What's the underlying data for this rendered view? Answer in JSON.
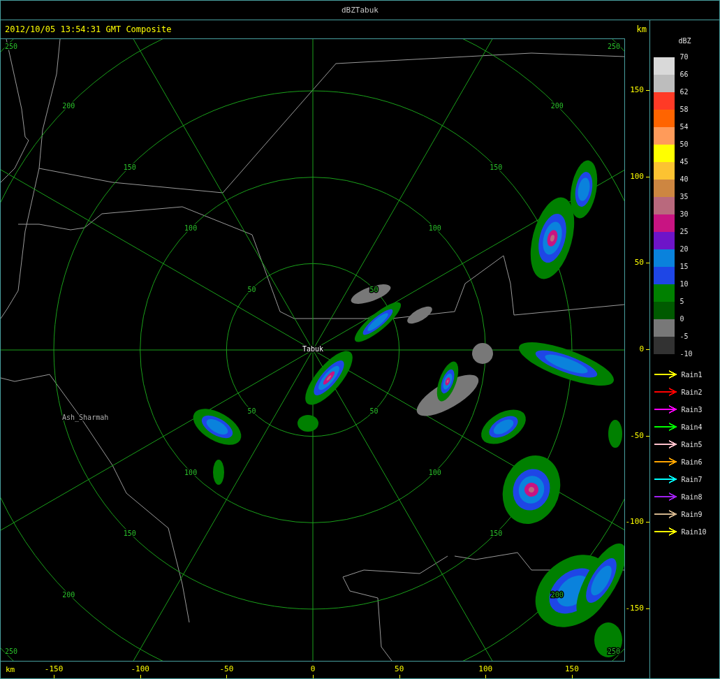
{
  "window": {
    "title": "dBZTabuk"
  },
  "header": {
    "timestamp": "2012/10/05 13:54:31 GMT Composite",
    "unit": "km"
  },
  "map": {
    "rings": [
      {
        "labels": [
          "50",
          "50",
          "50",
          "50"
        ]
      },
      {
        "labels": [
          "100",
          "100",
          "100",
          "100"
        ]
      },
      {
        "labels": [
          "150",
          "150",
          "150",
          "150"
        ]
      },
      {
        "labels": [
          "200",
          "200",
          "200",
          "200"
        ]
      },
      {
        "labels": [
          "250",
          "250",
          "250",
          "250"
        ]
      }
    ],
    "places": [
      {
        "kind": "station",
        "name": "Tabuk"
      },
      {
        "kind": "town",
        "name": "Ash_Sharmah"
      }
    ]
  },
  "x_axis": {
    "unit": "km",
    "ticks": [
      "-150",
      "-100",
      "-50",
      "0",
      "50",
      "100",
      "150"
    ]
  },
  "y_axis": {
    "ticks": [
      "150",
      "100",
      "50",
      "0",
      "-50",
      "-100",
      "-150"
    ]
  },
  "legend": {
    "title": "dBZ",
    "bands": [
      {
        "color": "#d9d9d9"
      },
      {
        "color": "#bdbdbd"
      },
      {
        "color": "#ff3a26"
      },
      {
        "color": "#ff6400"
      },
      {
        "color": "#ff9b5a"
      },
      {
        "color": "#ffff00"
      },
      {
        "color": "#fcc332"
      },
      {
        "color": "#cd8641"
      },
      {
        "color": "#b9697d"
      },
      {
        "color": "#c81482"
      },
      {
        "color": "#6e14c8"
      },
      {
        "color": "#0a82dc"
      },
      {
        "color": "#1e46e6"
      },
      {
        "color": "#008000"
      },
      {
        "color": "#005a00"
      },
      {
        "color": "#787878"
      },
      {
        "color": "#323232"
      }
    ],
    "labels": [
      "70",
      "66",
      "62",
      "58",
      "54",
      "50",
      "45",
      "40",
      "35",
      "30",
      "25",
      "20",
      "15",
      "10",
      "5",
      "0",
      "-5",
      "-10"
    ],
    "tracks": [
      {
        "label": "Rain1",
        "color": "#ffff00"
      },
      {
        "label": "Rain2",
        "color": "#ff0000"
      },
      {
        "label": "Rain3",
        "color": "#ff00ff"
      },
      {
        "label": "Rain4",
        "color": "#00ff00"
      },
      {
        "label": "Rain5",
        "color": "#ffc0cb"
      },
      {
        "label": "Rain6",
        "color": "#ffa500"
      },
      {
        "label": "Rain7",
        "color": "#00ffff"
      },
      {
        "label": "Rain8",
        "color": "#a020f0"
      },
      {
        "label": "Rain9",
        "color": "#d2b48c"
      },
      {
        "label": "Rain10",
        "color": "#ffff00"
      }
    ]
  }
}
